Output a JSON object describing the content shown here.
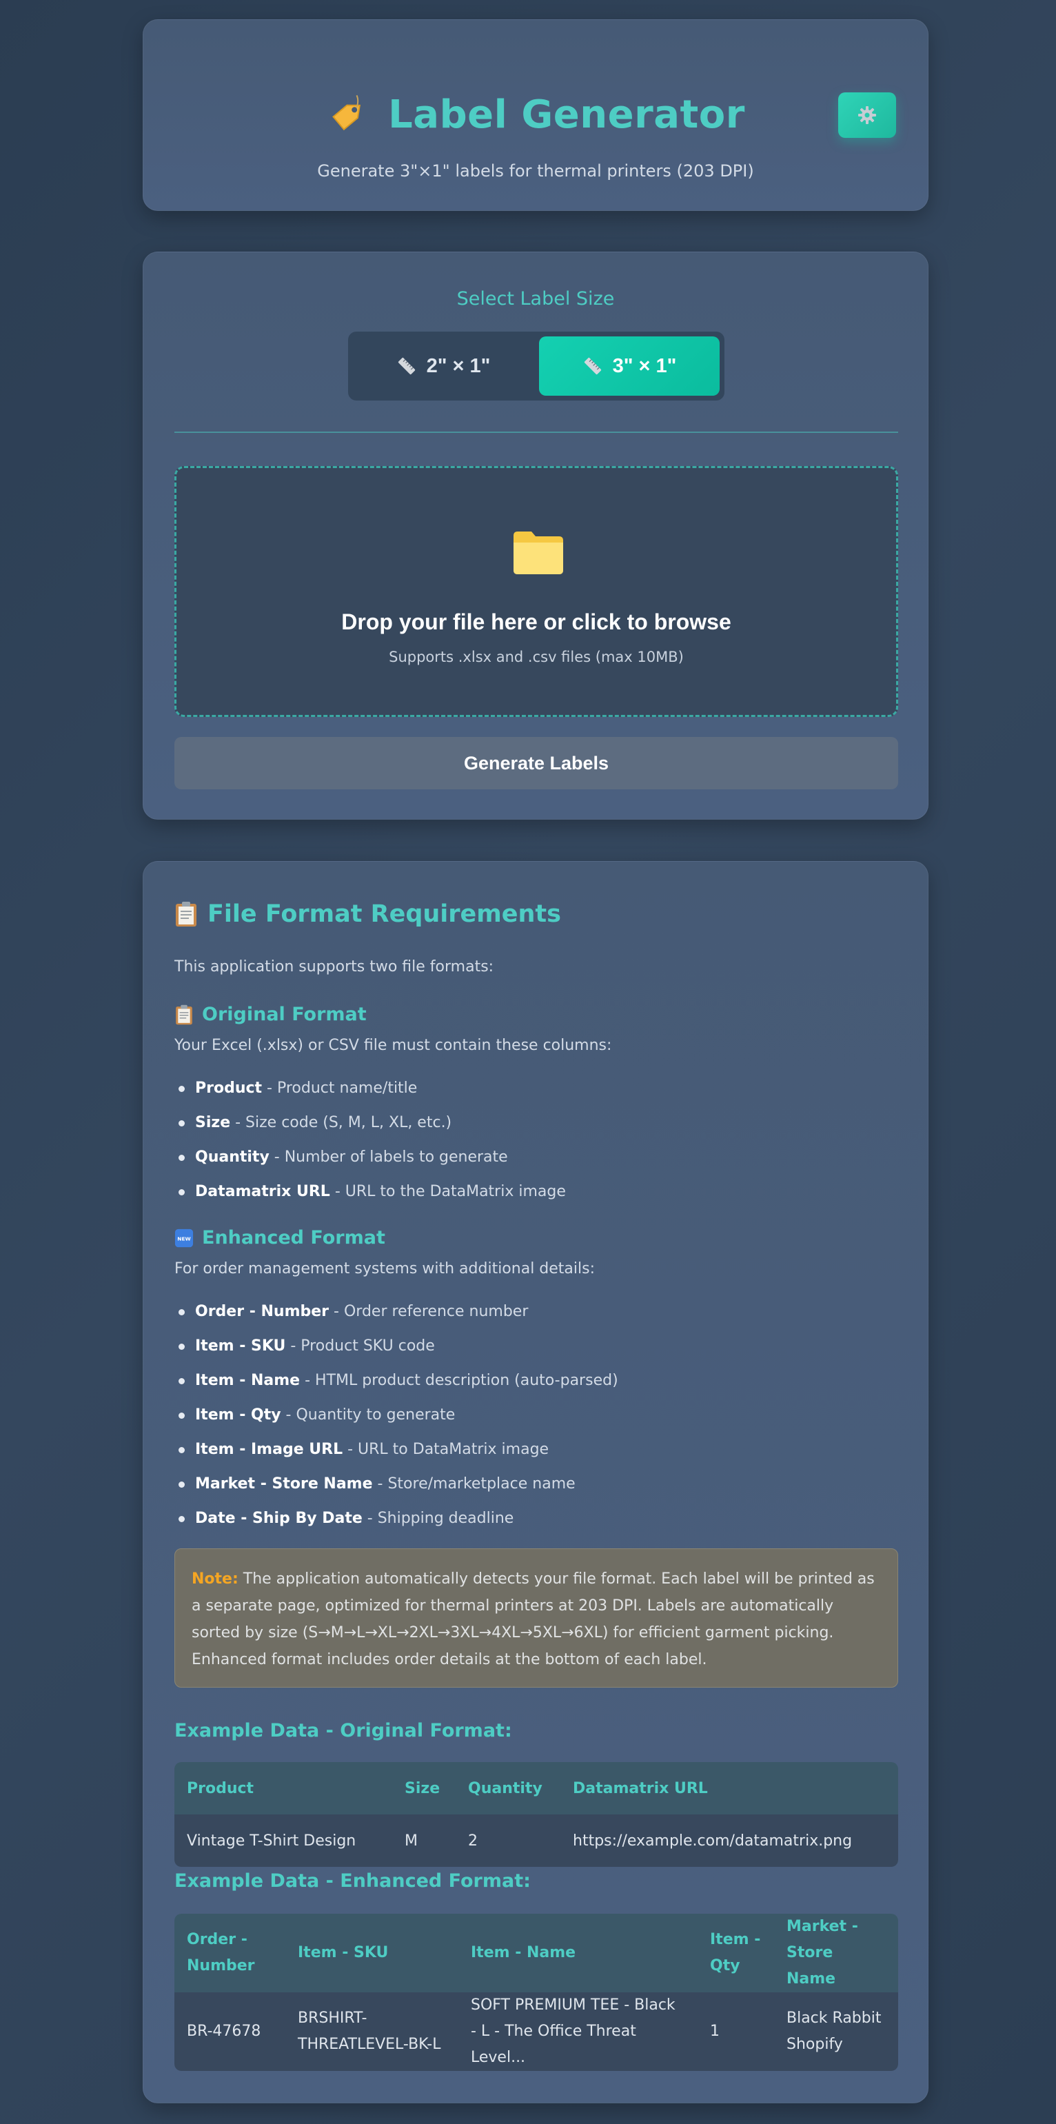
{
  "header": {
    "title": "Label Generator",
    "subtitle": "Generate 3\"×1\" labels for thermal printers (203 DPI)",
    "title_icon": "price-tag-icon",
    "settings_icon": "gear-icon"
  },
  "size_selector": {
    "label": "Select Label Size",
    "options": [
      {
        "label": "2\" × 1\"",
        "icon": "ruler-icon",
        "active": false
      },
      {
        "label": "3\" × 1\"",
        "icon": "ruler-icon",
        "active": true
      }
    ]
  },
  "dropzone": {
    "icon": "folder-icon",
    "title": "Drop your file here or click to browse",
    "subtitle": "Supports .xlsx and .csv files (max 10MB)"
  },
  "generate_button": "Generate Labels",
  "requirements": {
    "title": "File Format Requirements",
    "intro": "This application supports two file formats:",
    "original": {
      "title": "Original Format",
      "description": "Your Excel (.xlsx) or CSV file must contain these columns:",
      "columns": [
        {
          "name": "Product",
          "desc": " - Product name/title"
        },
        {
          "name": "Size",
          "desc": " - Size code (S, M, L, XL, etc.)"
        },
        {
          "name": "Quantity",
          "desc": " - Number of labels to generate"
        },
        {
          "name": "Datamatrix URL",
          "desc": " - URL to the DataMatrix image"
        }
      ]
    },
    "enhanced": {
      "title": "Enhanced Format",
      "description": "For order management systems with additional details:",
      "columns": [
        {
          "name": "Order - Number",
          "desc": " - Order reference number"
        },
        {
          "name": "Item - SKU",
          "desc": " - Product SKU code"
        },
        {
          "name": "Item - Name",
          "desc": " - HTML product description (auto-parsed)"
        },
        {
          "name": "Item - Qty",
          "desc": " - Quantity to generate"
        },
        {
          "name": "Item - Image URL",
          "desc": " - URL to DataMatrix image"
        },
        {
          "name": "Market - Store Name",
          "desc": " - Store/marketplace name"
        },
        {
          "name": "Date - Ship By Date",
          "desc": " - Shipping deadline"
        }
      ]
    },
    "note_label": "Note:",
    "note_text": " The application automatically detects your file format. Each label will be printed as a separate page, optimized for thermal printers at 203 DPI. Labels are automatically sorted by size (S→M→L→XL→2XL→3XL→4XL→5XL→6XL) for efficient garment picking. Enhanced format includes order details at the bottom of each label.",
    "example_original": {
      "title": "Example Data - Original Format:",
      "headers": [
        "Product",
        "Size",
        "Quantity",
        "Datamatrix URL"
      ],
      "rows": [
        [
          "Vintage T-Shirt Design",
          "M",
          "2",
          "https://example.com/datamatrix.png"
        ]
      ]
    },
    "example_enhanced": {
      "title": "Example Data - Enhanced Format:",
      "headers": [
        "Order - Number",
        "Item - SKU",
        "Item - Name",
        "Item - Qty",
        "Market - Store Name"
      ],
      "rows": [
        [
          "BR-47678",
          "BRSHIRT-THREATLEVEL-BK-L",
          "SOFT PREMIUM TEE - Black - L - The Office Threat Level...",
          "1",
          "Black Rabbit Shopify"
        ]
      ]
    }
  }
}
